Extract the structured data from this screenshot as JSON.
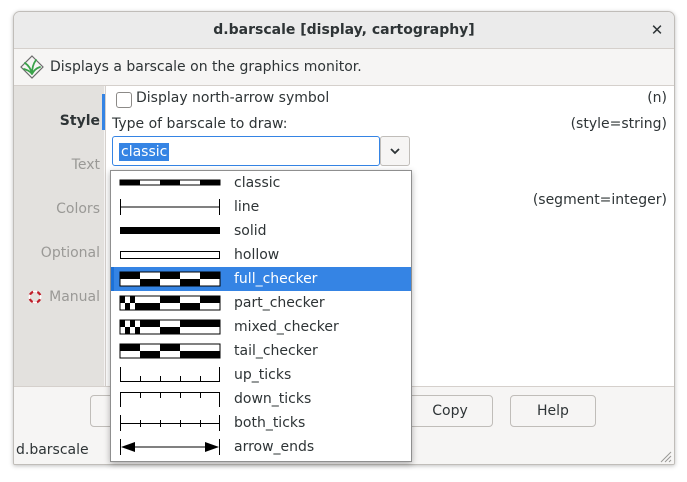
{
  "window": {
    "title": "d.barscale [display, cartography]",
    "close_glyph": "✕"
  },
  "description": "Displays a barscale on the graphics monitor.",
  "sidebar": {
    "items": [
      {
        "label": "Style"
      },
      {
        "label": "Text"
      },
      {
        "label": "Colors"
      },
      {
        "label": "Optional"
      },
      {
        "label": "Manual",
        "icon": "lifebuoy-icon"
      }
    ],
    "active": "Style"
  },
  "panel": {
    "north_arrow": {
      "label": "Display north-arrow symbol",
      "flag": "(n)",
      "checked": false
    },
    "style_field": {
      "label": "Type of barscale to draw:",
      "param": "(style=string)",
      "value": "classic"
    },
    "segment_param": "(segment=integer)"
  },
  "dropdown": {
    "selected": "full_checker",
    "options": [
      "classic",
      "line",
      "solid",
      "hollow",
      "full_checker",
      "part_checker",
      "mixed_checker",
      "tail_checker",
      "up_ticks",
      "down_ticks",
      "both_ticks",
      "arrow_ends"
    ]
  },
  "buttons": {
    "copy": "Copy",
    "help": "Help"
  },
  "status": "d.barscale",
  "colors": {
    "accent": "#3584e4"
  }
}
